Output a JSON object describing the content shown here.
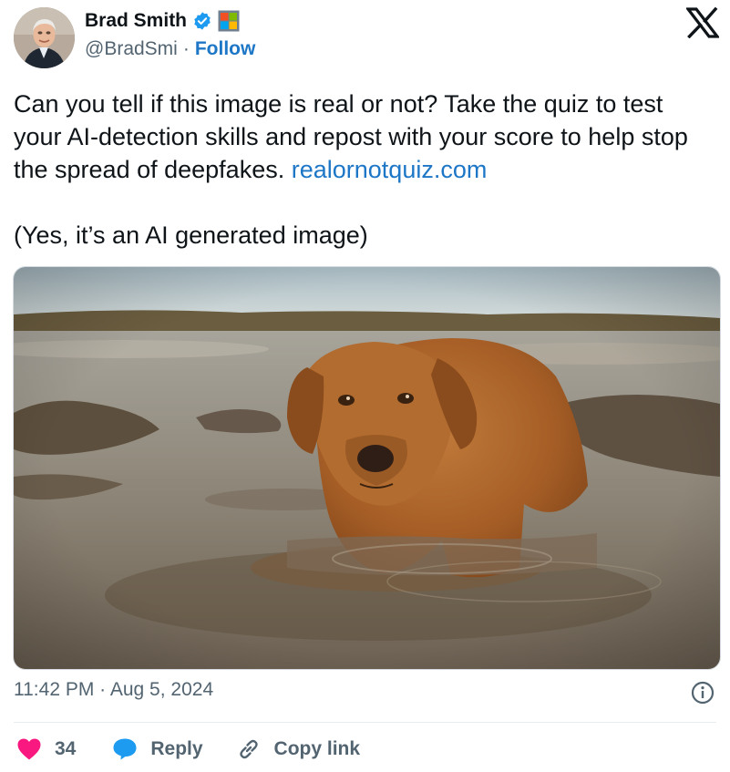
{
  "author": {
    "name": "Brad Smith",
    "handle": "@BradSmi",
    "follow_label": "Follow",
    "verified_icon": "verified-badge-icon",
    "affiliate_icon": "microsoft-logo-icon"
  },
  "tweet": {
    "text_main": "Can you tell if this image is real or not? Take the quiz to test your AI-detection skills and repost with your score to help stop the spread of deepfakes.",
    "link": "realornotquiz.com",
    "text_second": "(Yes, it’s an AI generated image)"
  },
  "meta": {
    "time": "11:42 PM",
    "separator": "·",
    "date": "Aug 5, 2024"
  },
  "actions": {
    "like_count": "34",
    "reply_label": "Reply",
    "copy_label": "Copy link"
  },
  "colors": {
    "link": "#1d77c6",
    "like": "#f91880",
    "reply": "#1d9bf0",
    "text": "#0f1419",
    "muted": "#536471"
  }
}
